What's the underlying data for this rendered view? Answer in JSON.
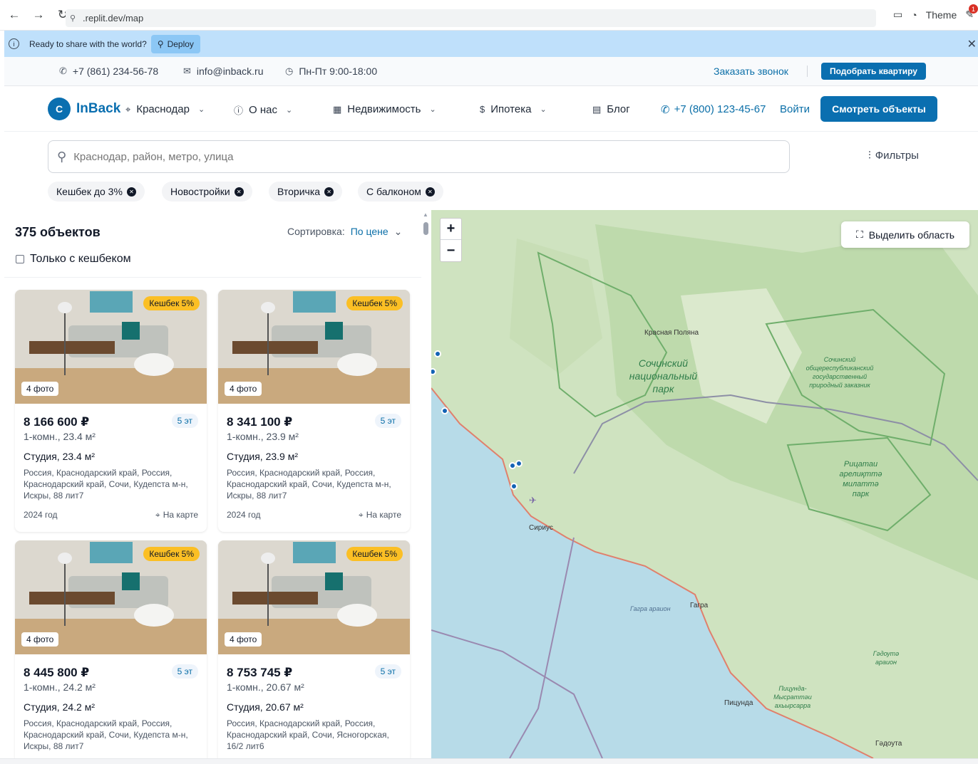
{
  "browser": {
    "url": ".replit.dev/map",
    "theme_label": "Theme",
    "notification_count": "1"
  },
  "deploy_banner": {
    "text": "Ready to share with the world?",
    "button": "Deploy"
  },
  "topbar": {
    "phone": "+7 (861) 234-56-78",
    "email": "info@inback.ru",
    "hours": "Пн-Пт 9:00-18:00",
    "call_link": "Заказать звонок",
    "pick_button": "Подобрать квартиру"
  },
  "header": {
    "logo_letter": "C",
    "logo_text": "InBack",
    "city": "Краснодар",
    "nav": [
      {
        "label": "О нас"
      },
      {
        "label": "Недвижимость"
      },
      {
        "label": "Ипотека"
      },
      {
        "label": "Блог"
      }
    ],
    "phone": "+7 (800) 123-45-67",
    "login": "Войти",
    "cta": "Смотреть объекты"
  },
  "search": {
    "placeholder": "Краснодар, район, метро, улица",
    "filters_label": "Фильтры",
    "chips": [
      {
        "label": "Кешбек до 3%"
      },
      {
        "label": "Новостройки"
      },
      {
        "label": "Вторичка"
      },
      {
        "label": "С балконом"
      }
    ]
  },
  "listing": {
    "count": "375 объектов",
    "sort_label": "Сортировка:",
    "sort_value": "По цене",
    "cashback_only": "Только с кешбеком",
    "cards": [
      {
        "cashback": "Кешбек 5%",
        "photos": "4 фото",
        "price": "8 166 600 ₽",
        "floor": "5 эт",
        "subtitle": "1-комн., 23.4 м²",
        "type": "Студия, 23.4 м²",
        "address": "Россия, Краснодарский край, Россия, Краснодарский край, Сочи, Кудепста м-н, Искры, 88 лит7",
        "year": "2024 год",
        "map_link": "На карте"
      },
      {
        "cashback": "Кешбек 5%",
        "photos": "4 фото",
        "price": "8 341 100 ₽",
        "floor": "5 эт",
        "subtitle": "1-комн., 23.9 м²",
        "type": "Студия, 23.9 м²",
        "address": "Россия, Краснодарский край, Россия, Краснодарский край, Сочи, Кудепста м-н, Искры, 88 лит7",
        "year": "2024 год",
        "map_link": "На карте"
      },
      {
        "cashback": "Кешбек 5%",
        "photos": "4 фото",
        "price": "8 445 800 ₽",
        "floor": "5 эт",
        "subtitle": "1-комн., 24.2 м²",
        "type": "Студия, 24.2 м²",
        "address": "Россия, Краснодарский край, Россия, Краснодарский край, Сочи, Кудепста м-н, Искры, 88 лит7",
        "year": "",
        "map_link": ""
      },
      {
        "cashback": "Кешбек 5%",
        "photos": "4 фото",
        "price": "8 753 745 ₽",
        "floor": "5 эт",
        "subtitle": "1-комн., 20.67 м²",
        "type": "Студия, 20.67 м²",
        "address": "Россия, Краснодарский край, Россия, Краснодарский край, Сочи, Ясногорская, 16/2 лит6",
        "year": "",
        "map_link": ""
      }
    ]
  },
  "map": {
    "zoom_in": "+",
    "zoom_out": "−",
    "select_area": "Выделить область",
    "labels": {
      "krasnaya_polyana": "Красная Поляна",
      "sochi_park": "Сочинский национальный парк",
      "reserve": "Сочинский общереспубликанский государственный природный заказник",
      "ritsa_park": "Рицатаи арелиқттә милаттә парк",
      "sirius": "Сириус",
      "gagra_district": "Гагра араион",
      "gagra": "Гагра",
      "gudauta_district": "Гәдоутә араион",
      "pitsunda_park": "Пицунда-Мысраттәи ахьырсарра",
      "pitsunda": "Пицунда",
      "gudauta": "Гәдоута"
    }
  }
}
